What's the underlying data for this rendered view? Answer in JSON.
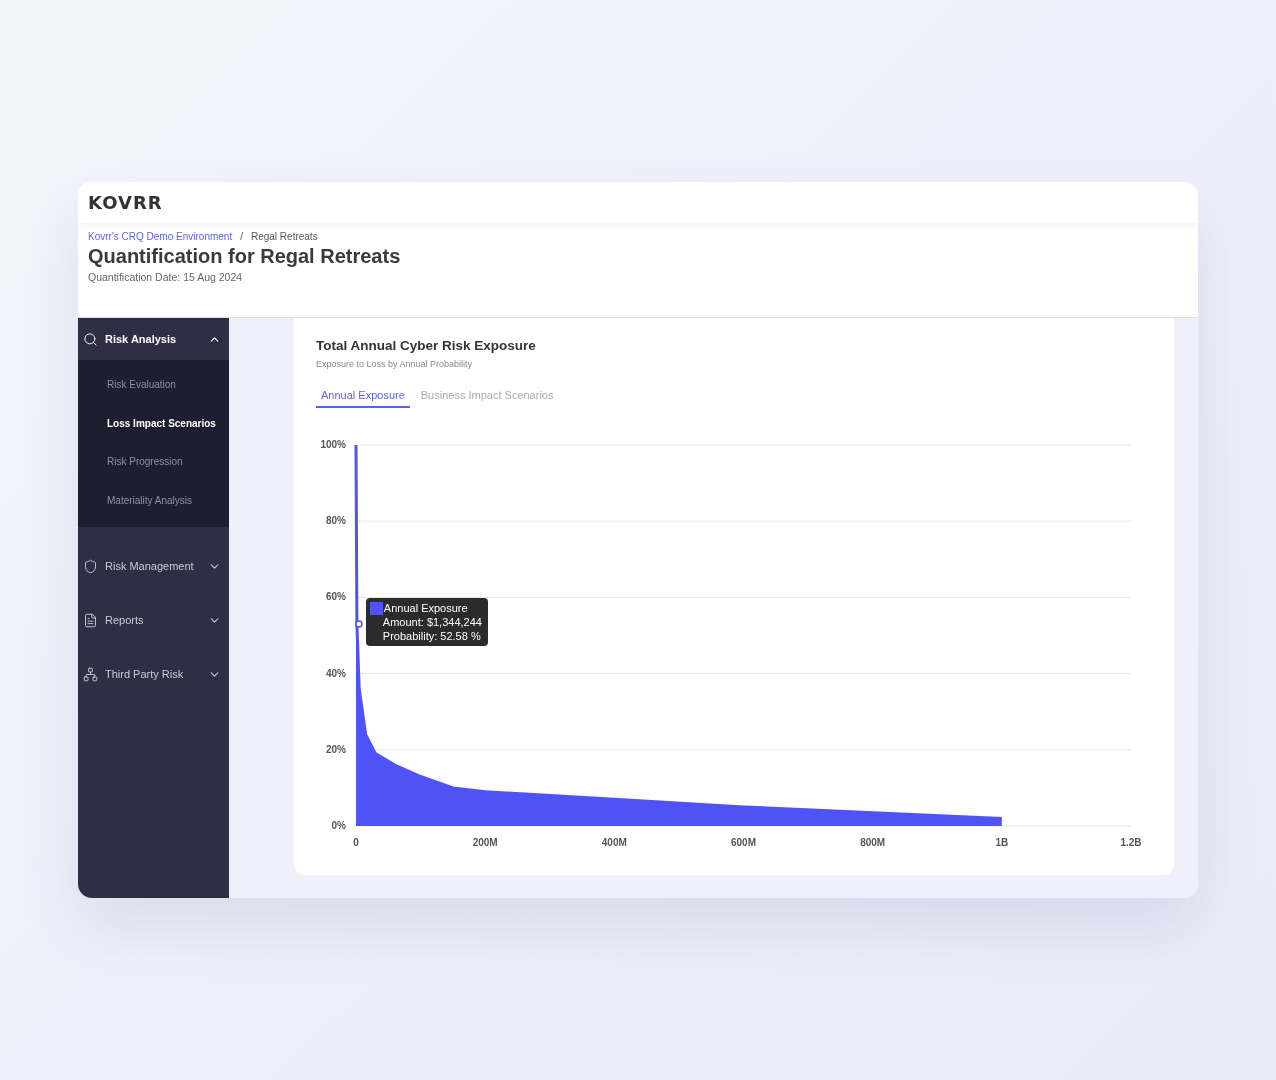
{
  "logo": "KOVRR",
  "breadcrumb": [
    {
      "label": "Kovrr's CRQ Demo Environment",
      "link": true
    },
    {
      "label": "/",
      "link": false
    },
    {
      "label": "Regal Retreats",
      "link": false
    }
  ],
  "title": "Quantification for Regal Retreats",
  "subtitle": "Quantification Date: 15 Aug 2024",
  "sidebar": [
    {
      "label": "Risk Analysis",
      "expanded": true,
      "children": [
        {
          "label": "Risk Evaluation",
          "selected": false
        },
        {
          "label": "Loss Impact Scenarios",
          "selected": true
        },
        {
          "label": "Risk Progression",
          "selected": false
        },
        {
          "label": "Materiality Analysis",
          "selected": false
        }
      ]
    },
    {
      "label": "Risk Management",
      "expanded": false
    },
    {
      "label": "Reports",
      "expanded": false
    },
    {
      "label": "Third Party Risk",
      "expanded": false
    }
  ],
  "card": {
    "title": "Total Annual Cyber Risk Exposure",
    "subtitle": "Exposure to Loss by Annual Probability",
    "tabs": [
      {
        "label": "Annual Exposure",
        "selected": true
      },
      {
        "label": "Business Impact Scenarios",
        "selected": false
      }
    ],
    "chart_data": {
      "type": "area",
      "grid": true,
      "x": [
        0,
        1344244,
        5000000,
        15000000,
        30000000,
        60000000,
        100000000,
        150000000,
        200000000,
        400000000,
        600000000,
        800000000,
        1000000000
      ],
      "series": [
        {
          "name": "Annual Exposure",
          "color": "#4f52f5",
          "values": [
            100,
            53,
            36,
            24,
            19,
            16,
            13,
            10,
            9,
            7,
            5,
            3.5,
            2
          ]
        }
      ],
      "xlim": [
        0,
        1200000000
      ],
      "ylim": [
        0,
        100
      ],
      "xticks": [
        {
          "value": 0,
          "label": "0"
        },
        {
          "value": 200000000,
          "label": "200M"
        },
        {
          "value": 400000000,
          "label": "400M"
        },
        {
          "value": 600000000,
          "label": "600M"
        },
        {
          "value": 800000000,
          "label": "800M"
        },
        {
          "value": 1000000000,
          "label": "1B"
        },
        {
          "value": 1200000000,
          "label": "1.2B"
        }
      ],
      "yticks": [
        {
          "value": 0,
          "label": "0%"
        },
        {
          "value": 20,
          "label": "20%"
        },
        {
          "value": 40,
          "label": "40%"
        },
        {
          "value": 60,
          "label": "60%"
        },
        {
          "value": 80,
          "label": "80%"
        },
        {
          "value": 100,
          "label": "100%"
        }
      ]
    },
    "tooltip": {
      "lines": [
        "Amount: $1,344,244",
        "Probability: 52.58 %"
      ]
    }
  }
}
